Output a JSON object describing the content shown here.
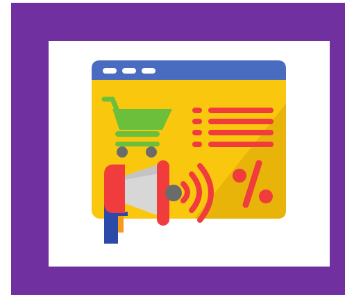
{
  "illustration": {
    "icon": "online-marketing-icon",
    "elements": [
      "browser-window-icon",
      "shopping-cart-icon",
      "list-lines-icon",
      "megaphone-icon",
      "percent-sign-icon",
      "sound-waves-icon"
    ]
  },
  "colors": {
    "frame_purple": "#7030a0",
    "panel_white": "#ffffff",
    "browser_bar_blue": "#4a6cc0",
    "browser_body_yellow": "#f9c80e",
    "browser_shadow_yellow": "#e8b40a",
    "cart_green": "#6cbf3a",
    "wheel_gray": "#6b6b6b",
    "accent_red": "#f03c3c",
    "megaphone_gray": "#d7d7d7",
    "handle_blue": "#2c4aa8",
    "handle_orange": "#f79a1a"
  }
}
